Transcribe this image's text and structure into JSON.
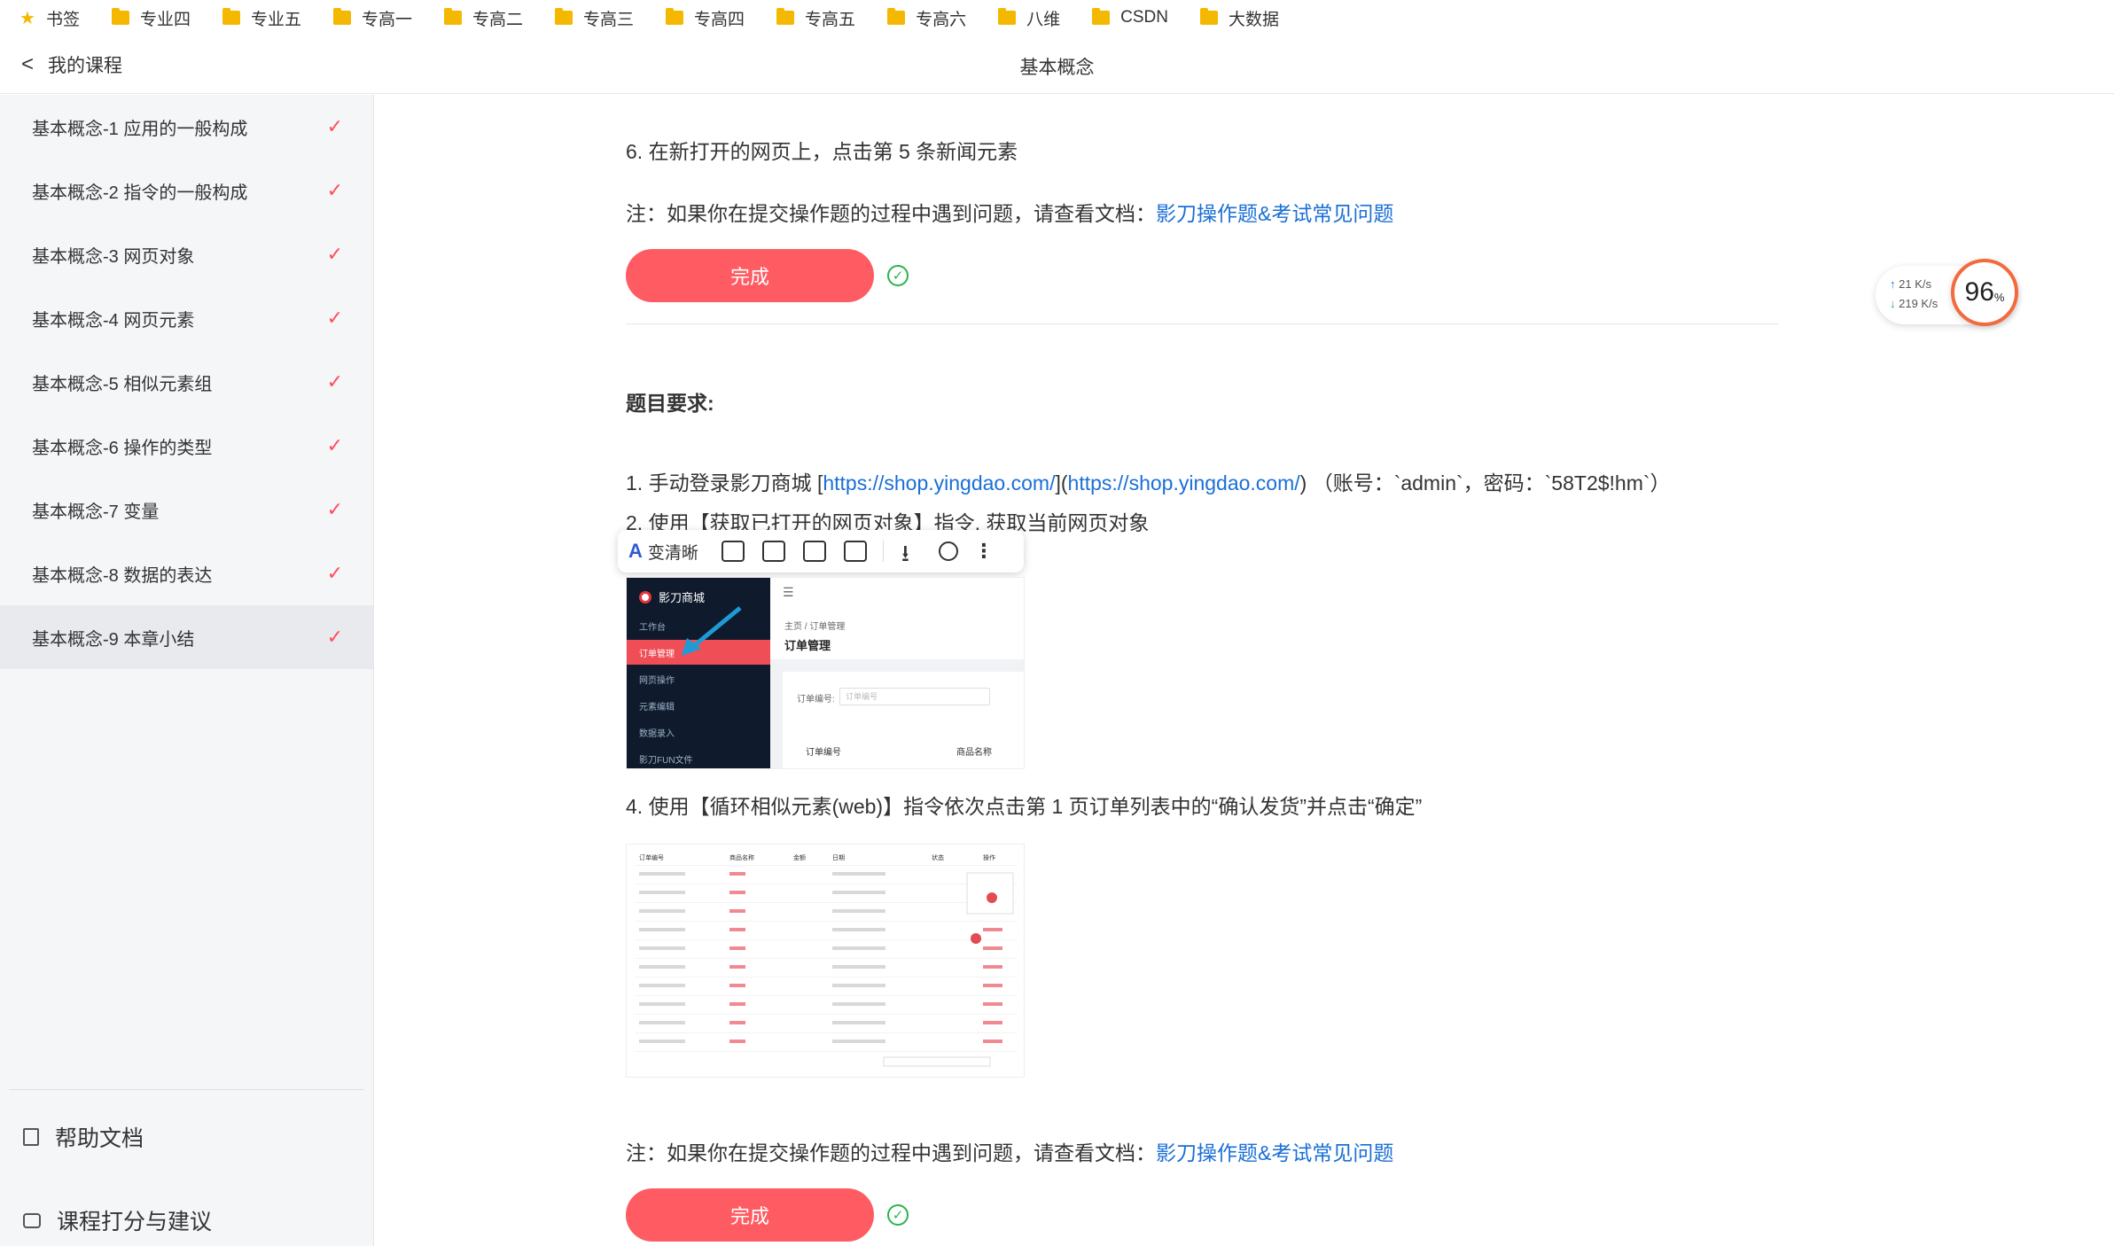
{
  "bookmarks": [
    {
      "label": "书签",
      "type": "star"
    },
    {
      "label": "专业四",
      "type": "folder"
    },
    {
      "label": "专业五",
      "type": "folder"
    },
    {
      "label": "专高一",
      "type": "folder"
    },
    {
      "label": "专高二",
      "type": "folder"
    },
    {
      "label": "专高三",
      "type": "folder"
    },
    {
      "label": "专高四",
      "type": "folder"
    },
    {
      "label": "专高五",
      "type": "folder"
    },
    {
      "label": "专高六",
      "type": "folder"
    },
    {
      "label": "八维",
      "type": "folder"
    },
    {
      "label": "CSDN",
      "type": "folder"
    },
    {
      "label": "大数据",
      "type": "folder"
    }
  ],
  "header": {
    "back_label": "我的课程",
    "title": "基本概念"
  },
  "sidebar": {
    "items": [
      {
        "label": "基本概念-1 应用的一般构成"
      },
      {
        "label": "基本概念-2 指令的一般构成"
      },
      {
        "label": "基本概念-3 网页对象"
      },
      {
        "label": "基本概念-4 网页元素"
      },
      {
        "label": "基本概念-5 相似元素组"
      },
      {
        "label": "基本概念-6 操作的类型"
      },
      {
        "label": "基本概念-7 变量"
      },
      {
        "label": "基本概念-8 数据的表达"
      },
      {
        "label": "基本概念-9 本章小结"
      }
    ],
    "help_label": "帮助文档",
    "feedback_label": "课程打分与建议"
  },
  "content": {
    "step6": "6. 在新打开的网页上，点击第 5 条新闻元素",
    "note_prefix": "注：如果你在提交操作题的过程中遇到问题，请查看文档：",
    "note_link": "影刀操作题&考试常见问题",
    "done_label": "完成",
    "section_heading": "题目要求:",
    "step1_prefix": "1. 手动登录影刀商城 [",
    "step1_url1": "https://shop.yingdao.com/",
    "step1_mid": "](",
    "step1_url2": "https://shop.yingdao.com/",
    "step1_suffix": ") （账号：`admin`，密码：`58T2$!hm`）",
    "step2": "2. 使用【获取已打开的网页对象】指令, 获取当前网页对象",
    "step4": "4. 使用【循环相似元素(web)】指令依次点击第 1 页订单列表中的“确认发货”并点击“确定”"
  },
  "image_toolbar": {
    "ai_icon": "A",
    "enhance_label": "变清晰"
  },
  "screenshot1": {
    "logo": "影刀商城",
    "menu": [
      "工作台",
      "订单管理",
      "网页操作",
      "元素编辑",
      "数据录入",
      "影刀FUN文件"
    ],
    "breadcrumb": "主页 / 订单管理",
    "page_heading": "订单管理",
    "field_label": "订单编号:",
    "field_placeholder": "订单编号",
    "col1": "订单编号",
    "col2": "商品名称"
  },
  "screenshot2": {
    "headers": [
      "订单编号",
      "商品名称",
      "金额",
      "日期",
      "状态",
      "操作"
    ]
  },
  "net_speed": {
    "up": "21 K/s",
    "down": "219 K/s",
    "percent": "96",
    "percent_unit": "%"
  },
  "colors": {
    "accent": "#fe5c62",
    "check": "#ff4d5a",
    "link": "#1a6fd6",
    "success": "#2bb34d"
  }
}
